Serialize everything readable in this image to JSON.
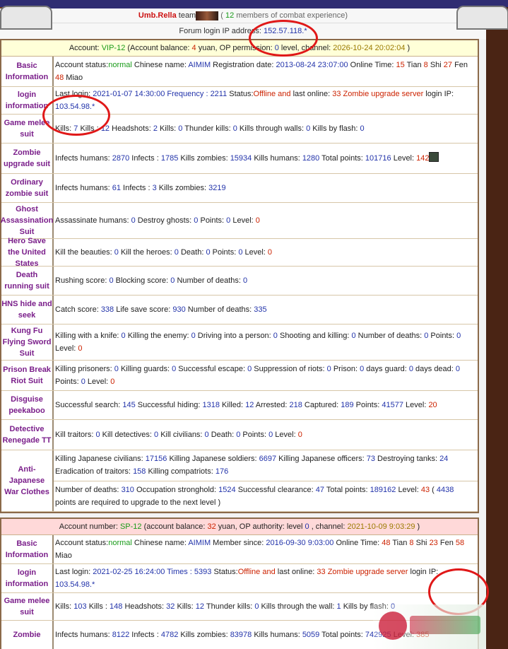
{
  "header": {
    "name": "Umb.Rella",
    "team_label": "team",
    "members_prefix": "( ",
    "members_count": "12",
    "members_suffix": " members of combat experience)",
    "forum_ip_label": "Forum login IP address:",
    "forum_ip": "152.57.118.*"
  },
  "account1": {
    "pre": "Account:",
    "id": "VIP-12",
    "bal_pre": " (Account balance:",
    "bal": "4",
    "bal_post": " yuan, OP permission:",
    "perm": "0",
    "perm_post": " level, channel:",
    "date": "2026-10-24 20:02:04",
    "close": " )",
    "basic": {
      "label": "Basic Information",
      "status_label": "Account status:",
      "status": "normal",
      "cn_label": " Chinese name: ",
      "cn": "AIMIM",
      "reg_label": " Registration date: ",
      "reg": "2013-08-24 23:07:00",
      "ot_label": " Online Time: ",
      "t1": "15",
      "t1u": " Tian ",
      "t2": "8",
      "t2u": " Shi ",
      "t3": "27",
      "t3u": " Fen ",
      "t4": "48",
      "t4u": " Miao"
    },
    "login": {
      "label": "login information",
      "ll_label": "Last login: ",
      "ll": "2021-01-07 14:30:00",
      "freq_label": " Frequency : ",
      "freq": "2211",
      "st_label": " Status:",
      "st": "Offline and",
      "lo_label": " last online: ",
      "lo": "33 Zombie upgrade server",
      "ip_label": " login IP: ",
      "ip": "103.54.98.*"
    },
    "rows": [
      {
        "label": "Game melee suit",
        "text": "Kills: 7 Kills : 12 Headshots: 2 Kills: 0 Thunder kills: 0 Kills through walls: 0 Kills by flash: 0"
      },
      {
        "label": "Zombie upgrade suit",
        "text": "Infects humans: 2870 Infects : 1785 Kills zombies: 15934 Kills humans: 1280 Total points: 101716 Level: 142"
      },
      {
        "label": "Ordinary zombie suit",
        "text": "Infects humans: 61 Infects : 3 Kills zombies: 3219"
      },
      {
        "label": "Ghost Assassination Suit",
        "text": "Assassinate humans: 0 Destroy ghosts: 0 Points: 0 Level: 0"
      },
      {
        "label": "Hero Save the United States",
        "text": "Kill the beauties: 0 Kill the heroes: 0 Death: 0 Points: 0 Level: 0"
      },
      {
        "label": "Death running suit",
        "text": "Rushing score: 0 Blocking score: 0 Number of deaths: 0"
      },
      {
        "label": "HNS hide and seek",
        "text": "Catch score: 338 Life save score: 930 Number of deaths: 335"
      },
      {
        "label": "Kung Fu Flying Sword Suit",
        "text": "Killing with a knife: 0 Killing the enemy: 0 Driving into a person: 0 Shooting and killing: 0 Number of deaths: 0 Points: 0 Level: 0"
      },
      {
        "label": "Prison Break Riot Suit",
        "text": "Killing prisoners: 0 Killing guards: 0 Successful escape: 0 Suppression of riots: 0 Prison: 0 days guard: 0 days dead: 0 Points: 0 Level: 0"
      },
      {
        "label": "Disguise peekaboo",
        "text": "Successful search: 145 Successful hiding: 1318 Killed: 12 Arrested: 218 Captured: 189 Points: 41577 Level: 20"
      },
      {
        "label": "Detective Renegade TT",
        "text": "Kill traitors: 0 Kill detectives: 0 Kill civilians: 0 Death: 0 Points: 0 Level: 0"
      }
    ],
    "war": {
      "label": "Anti-Japanese War Clothes",
      "line1": "Killing Japanese civilians: 17156 Killing Japanese soldiers: 6697 Killing Japanese officers: 73 Destroying tanks: 24 Eradication of traitors: 158 Killing compatriots: 176",
      "line2": "Number of deaths: 310 Occupation stronghold: 1524 Successful clearance: 47 Total points: 189162 Level: 43 ( 4438 points are required to upgrade to the next level )"
    }
  },
  "account2": {
    "pre": "Account number:",
    "id": "SP-12",
    "bal_pre": " (account balance:",
    "bal": "32",
    "bal_post": " yuan, OP authority: level",
    "perm": "0",
    "perm_post": " , channel:",
    "date": "2021-10-09 9:03:29",
    "close": " )",
    "basic": {
      "label": "Basic Information",
      "status_label": "Account status:",
      "status": "normal",
      "cn_label": " Chinese name: ",
      "cn": "AIMIM",
      "reg_label": " Member since: ",
      "reg": "2016-09-30 9:03:00",
      "ot_label": " Online Time: ",
      "t1": "48",
      "t1u": " Tian ",
      "t2": "8",
      "t2u": " Shi ",
      "t3": "23",
      "t3u": " Fen ",
      "t4": "58",
      "t4u": " Miao"
    },
    "login": {
      "label": "login information",
      "ll_label": "Last login: ",
      "ll": "2021-02-25 16:24:00",
      "freq_label": " Times : ",
      "freq": "5393",
      "st_label": " Status:",
      "st": "Offline and",
      "lo_label": " last online: ",
      "lo": "33 Zombie upgrade server",
      "ip_label": " login IP: ",
      "ip": "103.54.98.*"
    },
    "rows": [
      {
        "label": "Game melee suit",
        "text": "Kills: 103 Kills : 148 Headshots: 32 Kills: 12 Thunder kills: 0 Kills through the wall: 1 Kills by flash: 0"
      },
      {
        "label": "Zombie",
        "text": "Infects humans: 8122 Infects : 4782 Kills zombies: 83978 Kills humans: 5059 Total points: 742925 Level: 385"
      }
    ]
  }
}
